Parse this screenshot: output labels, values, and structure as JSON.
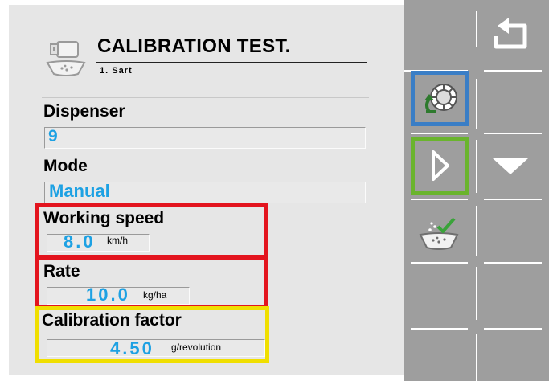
{
  "header": {
    "title": "CALIBRATION TEST.",
    "step": "1. Sart",
    "icon": "seed-dispenser-icon"
  },
  "fields": {
    "dispenser": {
      "label": "Dispenser",
      "value": "9"
    },
    "mode": {
      "label": "Mode",
      "value": "Manual"
    },
    "working_speed": {
      "label": "Working speed",
      "value": "8.0",
      "unit": "km/h"
    },
    "rate": {
      "label": "Rate",
      "value": "10.0",
      "unit": "kg/ha"
    },
    "calibration_factor": {
      "label": "Calibration factor",
      "value": "4.50",
      "unit": "g/revolution"
    }
  },
  "toolbar": {
    "buttons": [
      {
        "name": "back-icon"
      },
      {
        "name": "dispenser-rotate-icon"
      },
      {
        "name": "play-icon"
      },
      {
        "name": "arrow-down-icon"
      },
      {
        "name": "calibration-confirm-icon"
      }
    ]
  },
  "colors": {
    "value_text": "#1da1e3",
    "highlight_red": "#e3141e",
    "highlight_yellow": "#f0df00",
    "highlight_blue": "#3a7ec6",
    "highlight_green": "#6ab42d",
    "sidebar": "#9e9e9e"
  }
}
